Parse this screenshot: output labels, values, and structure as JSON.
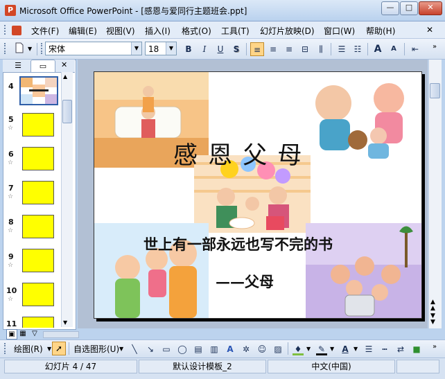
{
  "window": {
    "title": "Microsoft Office PowerPoint - [感恩与爱同行主题班会.ppt]",
    "app_icon": "P",
    "minimize": "—",
    "restore": "□",
    "close": "✕"
  },
  "menu": [
    "文件(F)",
    "编辑(E)",
    "视图(V)",
    "插入(I)",
    "格式(O)",
    "工具(T)",
    "幻灯片放映(D)",
    "窗口(W)",
    "帮助(H)"
  ],
  "toolbar": {
    "font_name": "宋体",
    "font_size": "18",
    "bold": "B",
    "italic": "I",
    "underline": "U",
    "shadow": "S",
    "grow_font": "A",
    "shrink_font": "A"
  },
  "panel_tabs": {
    "outline": "☰",
    "slides": "▭",
    "close": "✕"
  },
  "slides": [
    {
      "num": "4"
    },
    {
      "num": "5"
    },
    {
      "num": "6"
    },
    {
      "num": "7"
    },
    {
      "num": "8"
    },
    {
      "num": "9"
    },
    {
      "num": "10"
    },
    {
      "num": "11"
    }
  ],
  "slide_content": {
    "title": "感 恩 父 母",
    "subtitle": "世上有一部永远也写不完的书",
    "caption": "——父母"
  },
  "drawing": {
    "draw_label": "绘图(R)",
    "autoshapes_label": "自选图形(U)"
  },
  "status": {
    "slide_info": "幻灯片 4 / 47",
    "template": "默认设计模板_2",
    "language": "中文(中国)"
  },
  "colors": {
    "accent": "#ffff00",
    "titlebar": "#c3d7f0"
  }
}
